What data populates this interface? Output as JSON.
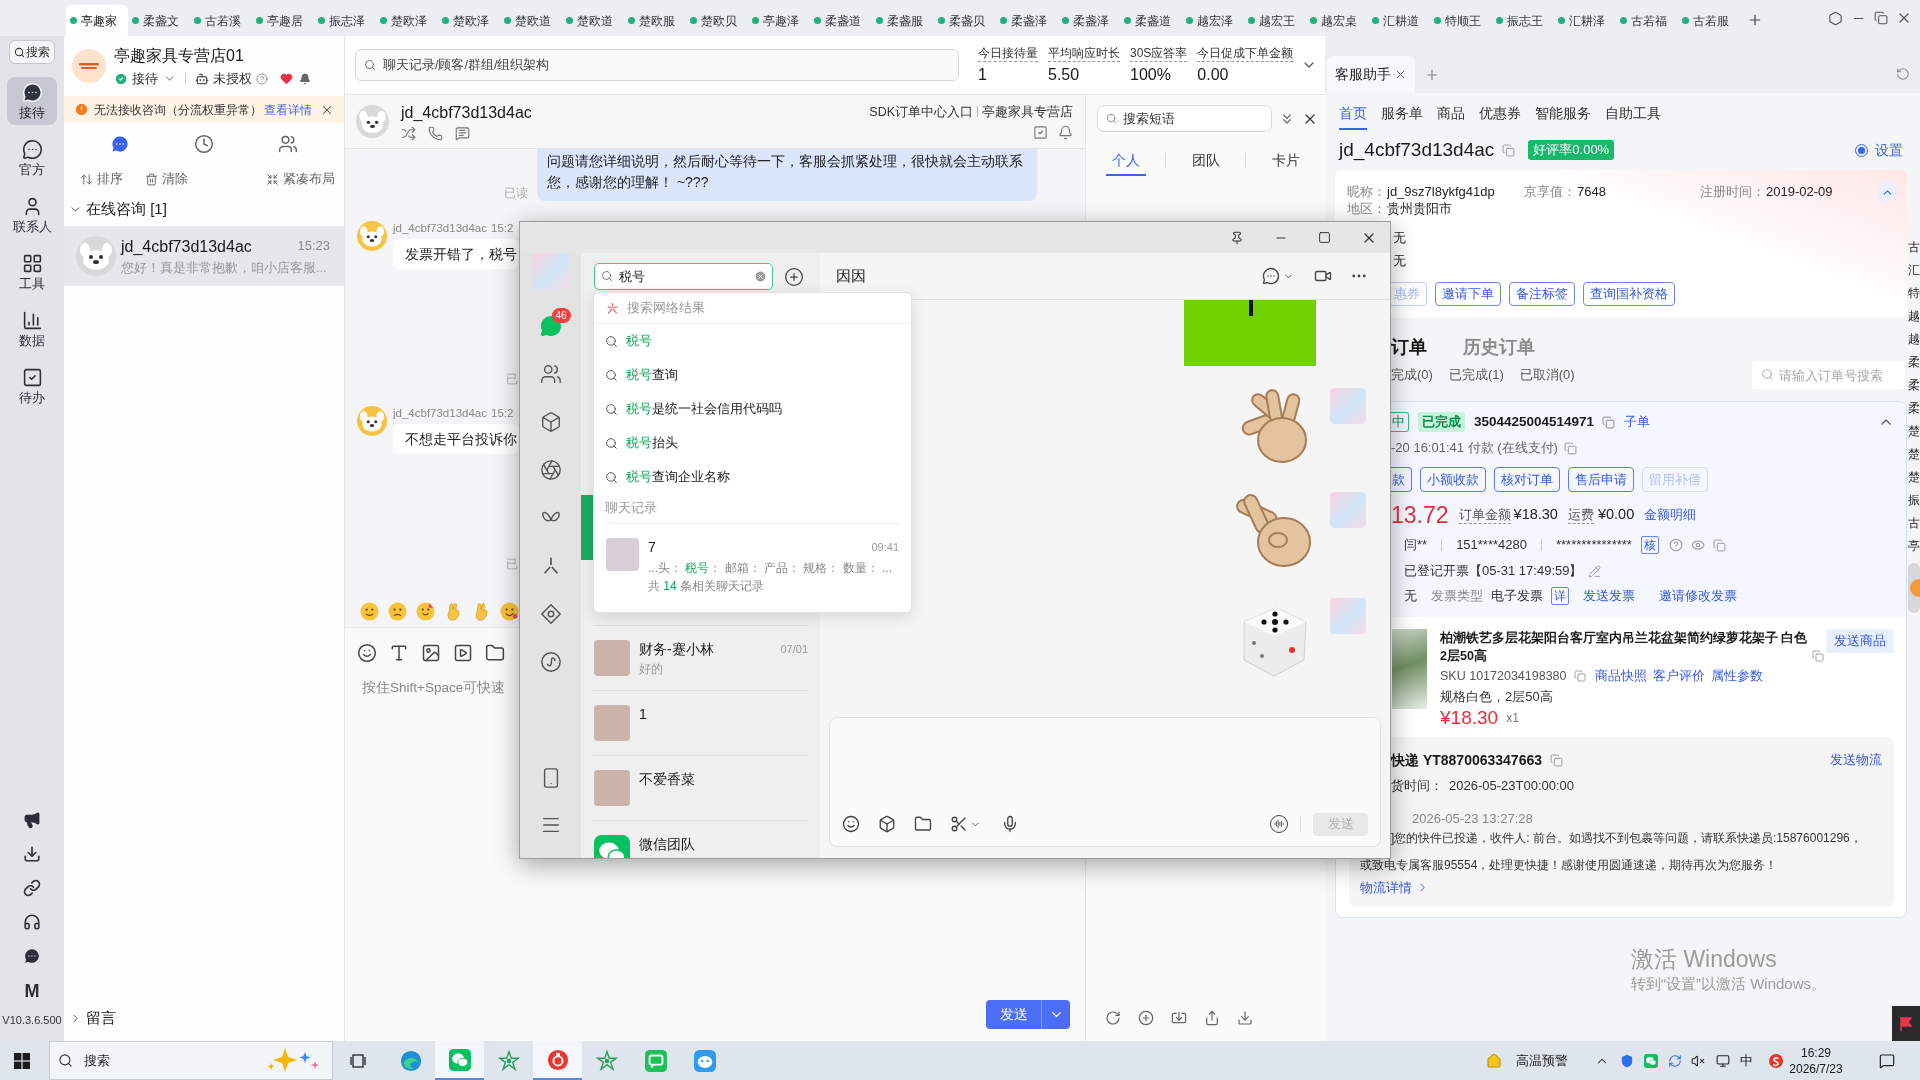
{
  "top_tabs": [
    {
      "label": "亭趣家",
      "selected": true
    },
    {
      "label": "柔盏文",
      "selected": false
    },
    {
      "label": "古若溪",
      "selected": false
    },
    {
      "label": "亭趣居",
      "selected": false
    },
    {
      "label": "振志泽",
      "selected": false
    },
    {
      "label": "楚欧泽",
      "selected": false
    },
    {
      "label": "楚欧泽",
      "selected": false
    },
    {
      "label": "楚欧道",
      "selected": false
    },
    {
      "label": "楚欧道",
      "selected": false
    },
    {
      "label": "楚欧服",
      "selected": false
    },
    {
      "label": "楚欧贝",
      "selected": false
    },
    {
      "label": "亭趣泽",
      "selected": false
    },
    {
      "label": "柔盏道",
      "selected": false
    },
    {
      "label": "柔盏服",
      "selected": false
    },
    {
      "label": "柔盏贝",
      "selected": false
    },
    {
      "label": "柔盏泽",
      "selected": false
    },
    {
      "label": "柔盏泽",
      "selected": false
    },
    {
      "label": "柔盏道",
      "selected": false
    },
    {
      "label": "越宏泽",
      "selected": false
    },
    {
      "label": "越宏王",
      "selected": false
    },
    {
      "label": "越宏桌",
      "selected": false
    },
    {
      "label": "汇耕道",
      "selected": false
    },
    {
      "label": "特顺王",
      "selected": false
    },
    {
      "label": "振志王",
      "selected": false
    },
    {
      "label": "汇耕泽",
      "selected": false
    },
    {
      "label": "古若福",
      "selected": false
    },
    {
      "label": "古若服",
      "selected": false
    }
  ],
  "app_nav": {
    "search": "搜索",
    "items": [
      {
        "label": "接待",
        "selected": true
      },
      {
        "label": "官方",
        "selected": false
      },
      {
        "label": "联系人",
        "selected": false
      },
      {
        "label": "工具",
        "selected": false
      },
      {
        "label": "数据",
        "selected": false
      },
      {
        "label": "待办",
        "selected": false
      }
    ],
    "logo": "M",
    "version": "V10.3.6.500"
  },
  "store": {
    "name": "亭趣家具专营店01",
    "status": "接待",
    "auth": "未授权"
  },
  "alert": {
    "text": "无法接收咨询（分流权重异常）",
    "link": "查看详情"
  },
  "session_tabs": [
    {
      "kind": "chat",
      "selected": true
    },
    {
      "kind": "history",
      "selected": false
    },
    {
      "kind": "team",
      "selected": false
    }
  ],
  "session_actions": [
    "排序",
    "清除",
    "紧凑布局"
  ],
  "session_groups": [
    {
      "label": "在线咨询 [1]",
      "expanded": true,
      "sessions": [
        {
          "name": "jd_4cbf73d13d4ac",
          "time": "15:23",
          "preview": "您好！真是非常抱歉，咱小店客服...",
          "selected": true
        }
      ]
    },
    {
      "label": "留言",
      "expanded": false
    }
  ],
  "global_search": {
    "placeholder": "聊天记录/顾客/群组/组织架构"
  },
  "stats": [
    {
      "label": "今日接待量",
      "value": "1"
    },
    {
      "label": "平均响应时长",
      "value": "5.50"
    },
    {
      "label": "30S应答率",
      "value": "100%"
    },
    {
      "label": "今日促成下单金额",
      "value": "0.00"
    }
  ],
  "chat": {
    "title": "jd_4cbf73d13d4ac",
    "links": [
      "SDK订单中心入口",
      "亭趣家具专营店"
    ],
    "messages": [
      {
        "kind": "outgoing",
        "text": "问题请您详细说明，然后耐心等待一下，客服会抓紧处理，很快就会主动联系您，感谢您的理解！ ~???",
        "receipt": "已读"
      },
      {
        "kind": "incoming",
        "sender": "jd_4cbf73d13d4ac",
        "time": "15:2",
        "text": "发票开错了，税号"
      },
      {
        "kind": "receipt",
        "text": "已"
      },
      {
        "kind": "incoming",
        "sender": "jd_4cbf73d13d4ac",
        "time": "15:2",
        "text": "不想走平台投诉你"
      },
      {
        "kind": "receipt",
        "text": "已"
      }
    ],
    "input": {
      "placeholder": "按住Shift+Space可快速"
    },
    "send": "发送"
  },
  "quick_phrases": {
    "placeholder": "搜索短语",
    "tabs": [
      {
        "label": "个人",
        "selected": true
      },
      {
        "label": "团队",
        "selected": false
      },
      {
        "label": "卡片",
        "selected": false
      }
    ]
  },
  "assistant": {
    "tab": "客服助手",
    "nav": [
      {
        "label": "首页",
        "selected": true
      },
      {
        "label": "服务单",
        "selected": false
      },
      {
        "label": "商品",
        "selected": false
      },
      {
        "label": "优惠券",
        "selected": false
      },
      {
        "label": "智能服务",
        "selected": false
      },
      {
        "label": "自助工具",
        "selected": false
      }
    ],
    "customer": "jd_4cbf73d13d4ac",
    "rating": "好评率0.00%",
    "setting": {
      "label": "设置",
      "checked": true
    },
    "profile": [
      {
        "label": "昵称：",
        "value": "jd_9sz7l8ykfg41dp"
      },
      {
        "label": "京享值：",
        "value": "7648"
      },
      {
        "label": "注册时间：",
        "value": "2019-02-09"
      }
    ],
    "profile_expanded": true,
    "region": {
      "label": "地区：",
      "value": "贵州贵阳市"
    },
    "profile_values": [
      "无",
      "无"
    ],
    "profile_actions": [
      "惠券",
      "邀请下单",
      "备注标签",
      "查询国补资格"
    ],
    "order_tabs": [
      {
        "label": "订单",
        "selected": true
      },
      {
        "label": "历史订单",
        "selected": false
      }
    ],
    "order_filters": [
      "完成(0)",
      "已完成(1)",
      "已取消(0)"
    ],
    "order_search": {
      "placeholder": "请输入订单号搜索"
    },
    "order": {
      "tags": [
        {
          "label": "中",
          "kind": "outline"
        },
        {
          "label": "已完成",
          "kind": "solid"
        }
      ],
      "number": "3504425004514971",
      "sub_link": "子单",
      "expanded": true,
      "paid": "-20 16:01:41 付款 (在线支付)",
      "actions": [
        {
          "label": "款",
          "disabled": false
        },
        {
          "label": "小额收款",
          "disabled": false
        },
        {
          "label": "核对订单",
          "disabled": false
        },
        {
          "label": "售后申请",
          "disabled": false
        },
        {
          "label": "留用补偿",
          "disabled": true
        }
      ],
      "paid_amount": "13.72",
      "total_label": "订单金额",
      "total": "¥18.30",
      "freight_label": "运费",
      "freight": "¥0.00",
      "breakdown_link": "金额明细",
      "buyer": "闫**",
      "phone": "151****4280",
      "address": "***************",
      "verify": "核",
      "invoice_status": "已登记开票【05-31 17:49:59】",
      "invoice_title": "无",
      "invoice_type_label": "发票类型",
      "invoice_type": "电子发票",
      "invoice_detail": "详",
      "invoice_links": [
        "发送发票",
        "邀请修改发票"
      ],
      "product": {
        "title": "柏潮铁艺多层花架阳台客厅室内吊兰花盆架简约绿萝花架子 白色 2层50高",
        "send": "发送商品",
        "sku": "SKU 10172034198380",
        "links": [
          "商品快照",
          "客户评价",
          "属性参数"
        ],
        "spec": "规格白色，2层50高",
        "price": "¥18.30",
        "quantity": "x1"
      },
      "logistics": {
        "carrier": "快递 YT8870063347663",
        "send": "发送物流",
        "ship_label": "货时间：",
        "ship_time": "2026-05-23T00:00:00",
        "event_time": "2026-05-23 13:27:28",
        "event_text": [
          "]您的快件已投递，收件人: 前台。如遇找不到包裹等问题，请联系快递员:15876001296，",
          "或致电专属客服95554，处理更快捷！感谢使用圆通速递，期待再次为您服务！"
        ],
        "detail_link": "物流详情"
      }
    }
  },
  "edge_list": [
    "古",
    "汇",
    "特",
    "越",
    "越",
    "柔",
    "柔",
    "柔",
    "楚",
    "楚",
    "楚",
    "振",
    "古",
    "亭"
  ],
  "wechat": {
    "unread": "46",
    "search": {
      "value": "税号"
    },
    "web_header": "搜索网络结果",
    "suggestions": [
      {
        "match": "税号"
      },
      {
        "match": "税号",
        "rest": "查询"
      },
      {
        "match": "税号",
        "rest": "是统一社会信用代码吗"
      },
      {
        "match": "税号",
        "rest": "抬头"
      },
      {
        "match": "税号",
        "rest": "查询企业名称"
      }
    ],
    "history_header": "聊天记录",
    "history": [
      {
        "name": "7",
        "time": "09:41",
        "snippet": [
          "...头： ",
          "税号",
          "： 邮箱： 产品： 规格： 数量： ..."
        ],
        "summary": [
          "共 ",
          "14",
          " 条相关聊天记录"
        ]
      }
    ],
    "covered_rows": [
      {
        "selected": false
      },
      {
        "selected": false
      },
      {
        "selected": false
      },
      {
        "selected": true
      },
      {
        "selected": false
      }
    ],
    "conversations": [
      {
        "kind": "photo",
        "name": "财务-蹇小林",
        "time": "07/01",
        "preview": "好的"
      },
      {
        "kind": "photo",
        "name": "1"
      },
      {
        "kind": "photo",
        "name": "不爱香菜"
      },
      {
        "kind": "official",
        "name": "微信团队"
      }
    ],
    "chat_title": "因因",
    "send": {
      "label": "发送",
      "disabled": true
    }
  },
  "activation": {
    "title": "激活 Windows",
    "hint": "转到“设置”以激活 Windows。"
  },
  "taskbar": {
    "search": {
      "placeholder": "搜索"
    },
    "apps": [
      {
        "kind": "edge",
        "active": false
      },
      {
        "kind": "wechat",
        "active": true
      },
      {
        "kind": "star",
        "active": false
      },
      {
        "kind": "red",
        "active": true
      },
      {
        "kind": "star",
        "active": false
      },
      {
        "kind": "chat",
        "active": false
      },
      {
        "kind": "blue",
        "active": false
      }
    ],
    "weather": "高温预警",
    "ime": "中",
    "time": "16:29",
    "date": "2026/7/23"
  }
}
